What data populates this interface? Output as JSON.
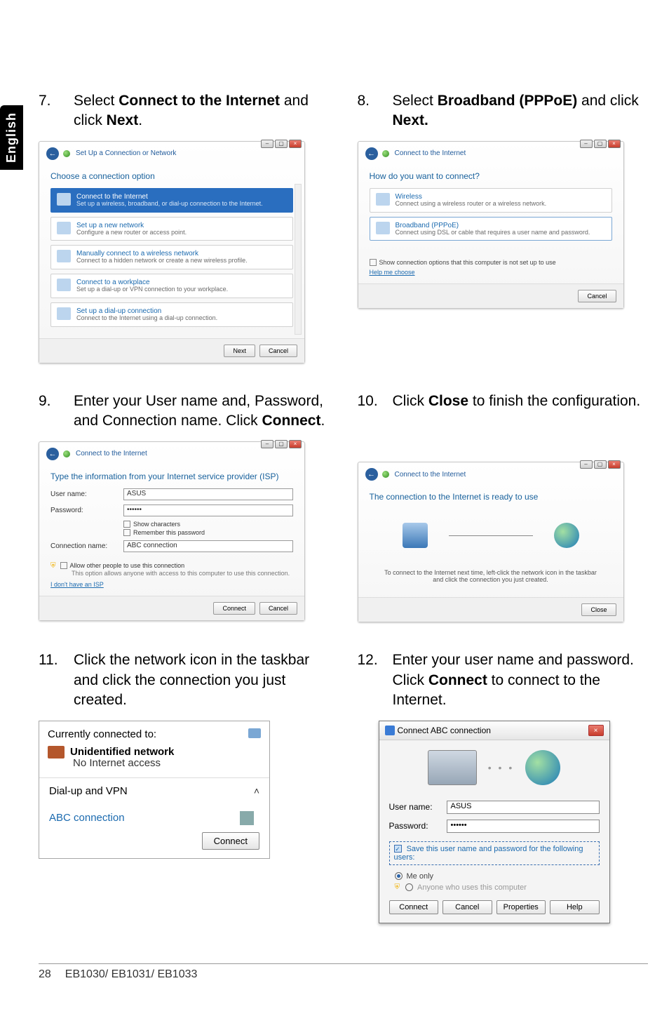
{
  "language_tab": "English",
  "footer": {
    "page_number": "28",
    "manual_models": "EB1030/ EB1031/ EB1033"
  },
  "step7": {
    "num": "7.",
    "body_pre": "Select ",
    "body_bold": "Connect to the Internet",
    "body_mid": " and click ",
    "body_bold2": "Next",
    "body_post": ".",
    "dialog": {
      "title": "Set Up a Connection or Network",
      "heading": "Choose a connection option",
      "options": [
        {
          "title": "Connect to the Internet",
          "sub": "Set up a wireless, broadband, or dial-up connection to the Internet."
        },
        {
          "title": "Set up a new network",
          "sub": "Configure a new router or access point."
        },
        {
          "title": "Manually connect to a wireless network",
          "sub": "Connect to a hidden network or create a new wireless profile."
        },
        {
          "title": "Connect to a workplace",
          "sub": "Set up a dial-up or VPN connection to your workplace."
        },
        {
          "title": "Set up a dial-up connection",
          "sub": "Connect to the Internet using a dial-up connection."
        }
      ],
      "next": "Next",
      "cancel": "Cancel"
    }
  },
  "step8": {
    "num": "8.",
    "body_pre": "Select ",
    "body_bold": "Broadband (PPPoE)",
    "body_mid": " and click ",
    "body_bold2": "Next.",
    "dialog": {
      "title": "Connect to the Internet",
      "heading": "How do you want to connect?",
      "options": [
        {
          "title": "Wireless",
          "sub": "Connect using a wireless router or a wireless network."
        },
        {
          "title": "Broadband (PPPoE)",
          "sub": "Connect using DSL or cable that requires a user name and password."
        }
      ],
      "show_note": "Show connection options that this computer is not set up to use",
      "help_link": "Help me choose",
      "cancel": "Cancel"
    }
  },
  "step9": {
    "num": "9.",
    "body": "Enter your User name and, Password, and Connection name. Click ",
    "body_bold": "Connect",
    "body_post": ".",
    "dialog": {
      "title": "Connect to the Internet",
      "heading": "Type the information from your Internet service provider (ISP)",
      "username_label": "User name:",
      "username_value": "ASUS",
      "password_label": "Password:",
      "password_value": "••••••",
      "show_chars": "Show characters",
      "remember": "Remember this password",
      "conn_label": "Connection name:",
      "conn_value": "ABC connection",
      "allow_others": "Allow other people to use this connection",
      "allow_others_sub": "This option allows anyone with access to this computer to use this connection.",
      "no_isp": "I don't have an ISP",
      "connect": "Connect",
      "cancel": "Cancel"
    }
  },
  "step10": {
    "num": "10.",
    "body_pre": "Click ",
    "body_bold": "Close",
    "body_post": " to finish the configuration.",
    "dialog": {
      "title": "Connect to the Internet",
      "heading": "The connection to the Internet is ready to use",
      "note": "To connect to the Internet next time, left-click the network icon in the taskbar and click the connection you just created.",
      "close": "Close"
    }
  },
  "step11": {
    "num": "11.",
    "body": "Click the network icon in the taskbar and click the connection you just created.",
    "flyout": {
      "hdr": "Currently connected to:",
      "net_name": "Unidentified network",
      "net_sub": "No Internet access",
      "section": "Dial-up and VPN",
      "conn_name": "ABC connection",
      "connect": "Connect"
    }
  },
  "step12": {
    "num": "12.",
    "body_pre": "Enter your user name and password. Click ",
    "body_bold": "Connect",
    "body_post": " to connect to the Internet.",
    "dialog": {
      "title": "Connect ABC connection",
      "username_label": "User name:",
      "username_value": "ASUS",
      "password_label": "Password:",
      "password_value": "••••••",
      "save_text": "Save this user name and password for the following users:",
      "me_only": "Me only",
      "anyone": "Anyone who uses this computer",
      "connect": "Connect",
      "cancel": "Cancel",
      "properties": "Properties",
      "help": "Help"
    }
  }
}
